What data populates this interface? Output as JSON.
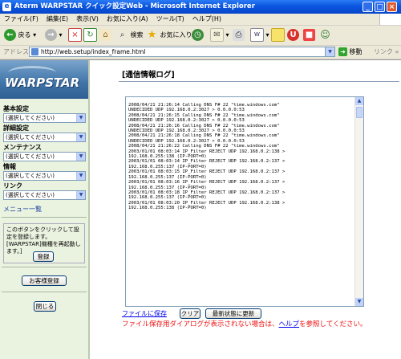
{
  "window": {
    "title": "Aterm WARPSTAR クイック設定Web - Microsoft Internet Explorer",
    "controls": {
      "minimize": "_",
      "maximize": "□",
      "close": "×"
    }
  },
  "menubar": {
    "items": [
      "ファイル(F)",
      "編集(E)",
      "表示(V)",
      "お気に入り(A)",
      "ツール(T)",
      "ヘルプ(H)"
    ]
  },
  "toolbar": {
    "back_label": "戻る",
    "search_label": "検索",
    "favorites_label": "お気に入り"
  },
  "address": {
    "label": "アドレス(D)",
    "url": "http://web.setup/index_frame.html",
    "go_label": "移動",
    "links_label": "リンク »"
  },
  "sidebar": {
    "logo_text": "WARPSTAR",
    "groups": [
      {
        "heading": "基本設定",
        "value": "(選択してください)"
      },
      {
        "heading": "詳細設定",
        "value": "(選択してください)"
      },
      {
        "heading": "メンテナンス",
        "value": "(選択してください)"
      },
      {
        "heading": "情報",
        "value": "(選択してください)"
      },
      {
        "heading": "リンク",
        "value": "(選択してください)"
      }
    ],
    "menu_list_link": "メニュー一覧",
    "note": "このボタンをクリックして設定を登録します。[WARPSTAR]機種を再起動します。]",
    "register_button": "登録",
    "customer_button": "お客様登録",
    "close_button": "閉じる"
  },
  "main": {
    "title": "[通信情報ログ]",
    "log_lines": [
      "2008/04/21 21:26:14 Calling DNS F# 22 \"time.windows.com\"",
      "UNDECIDED UDP 192.168.0.2:3027 > 0.0.0.0:53",
      "2008/04/21 21:26:15 Calling DNS F# 22 \"time.windows.com\"",
      "UNDECIDED UDP 192.168.0.2:3027 > 0.0.0.0:53",
      "2008/04/21 21:26:16 Calling DNS F# 22 \"time.windows.com\"",
      "UNDECIDED UDP 192.168.0.2:3027 > 0.0.0.0:53",
      "2008/04/21 21:26:18 Calling DNS F# 22 \"time.windows.com\"",
      "UNDECIDED UDP 192.168.0.2:3027 > 0.0.0.0:53",
      "2008/04/21 21:26:22 Calling DNS F# 22 \"time.windows.com\"",
      "2003/01/01 08:03:14 IP_Filter REJECT UDP 192.168.0.2:138 >",
      "192.168.0.255:138 (IP-PORT=0)",
      "2003/01/01 08:03:14 IP_Filter REJECT UDP 192.168.0.2:137 >",
      "192.168.0.255:137 (IP-PORT=0)",
      "2003/01/01 08:03:15 IP_Filter REJECT UDP 192.168.0.2:137 >",
      "192.168.0.255:137 (IP-PORT=0)",
      "2003/01/01 08:03:16 IP_Filter REJECT UDP 192.168.0.2:137 >",
      "192.168.0.255:137 (IP-PORT=0)",
      "2003/01/01 08:03:18 IP_Filter REJECT UDP 192.168.0.2:137 >",
      "192.168.0.255:137 (IP-PORT=0)",
      "2003/01/01 08:03:20 IP_Filter REJECT UDP 192.168.0.2:138 >",
      "192.168.0.255:138 (IP-PORT=0)"
    ],
    "save_link": "ファイルに保存",
    "clear_button": "クリア",
    "refresh_button": "最新状態に更新",
    "warning_prefix": "ファイル保存用ダイアログが表示されない場合は、",
    "warning_link": "ヘルプ",
    "warning_suffix": "を参照してください。"
  }
}
